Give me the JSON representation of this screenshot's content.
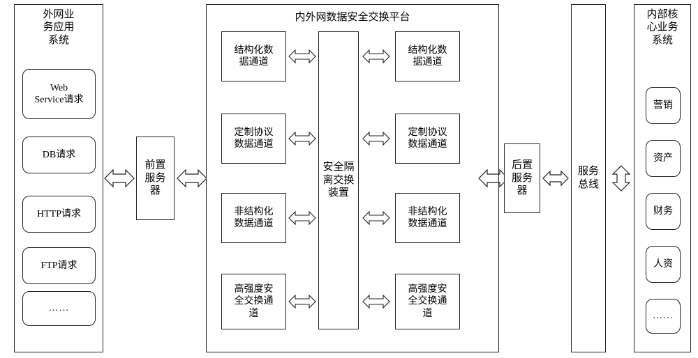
{
  "diagram": {
    "title": "内外网数据安全交换平台",
    "left_panel": {
      "title": "外网业\n务应用\n系统",
      "items": [
        {
          "label": "Web\nService请求"
        },
        {
          "label": "DB请求"
        },
        {
          "label": "HTTP请求"
        },
        {
          "label": "FTP请求"
        },
        {
          "label": "……"
        }
      ]
    },
    "front_server": {
      "label": "前置\n服务\n器"
    },
    "platform": {
      "title": "内外网数据安全交换平台",
      "left_channels": [
        {
          "label": "结构化数\n据通道"
        },
        {
          "label": "定制协议\n数据通道"
        },
        {
          "label": "非结构化\n数据通道"
        },
        {
          "label": "高强度安\n全交换通\n道"
        }
      ],
      "center_device": {
        "label": "安全隔\n离交换\n装置"
      },
      "right_channels": [
        {
          "label": "结构化数\n据通道"
        },
        {
          "label": "定制协议\n数据通道"
        },
        {
          "label": "非结构化\n数据通道"
        },
        {
          "label": "高强度安\n全交换通\n道"
        }
      ]
    },
    "back_server": {
      "label": "后置\n服务\n器"
    },
    "service_bus": {
      "label": "服务\n总线"
    },
    "right_panel": {
      "title": "内部核\n心业务\n系统",
      "items": [
        {
          "label": "营销"
        },
        {
          "label": "资产"
        },
        {
          "label": "财务"
        },
        {
          "label": "人资"
        },
        {
          "label": "……"
        }
      ]
    }
  }
}
